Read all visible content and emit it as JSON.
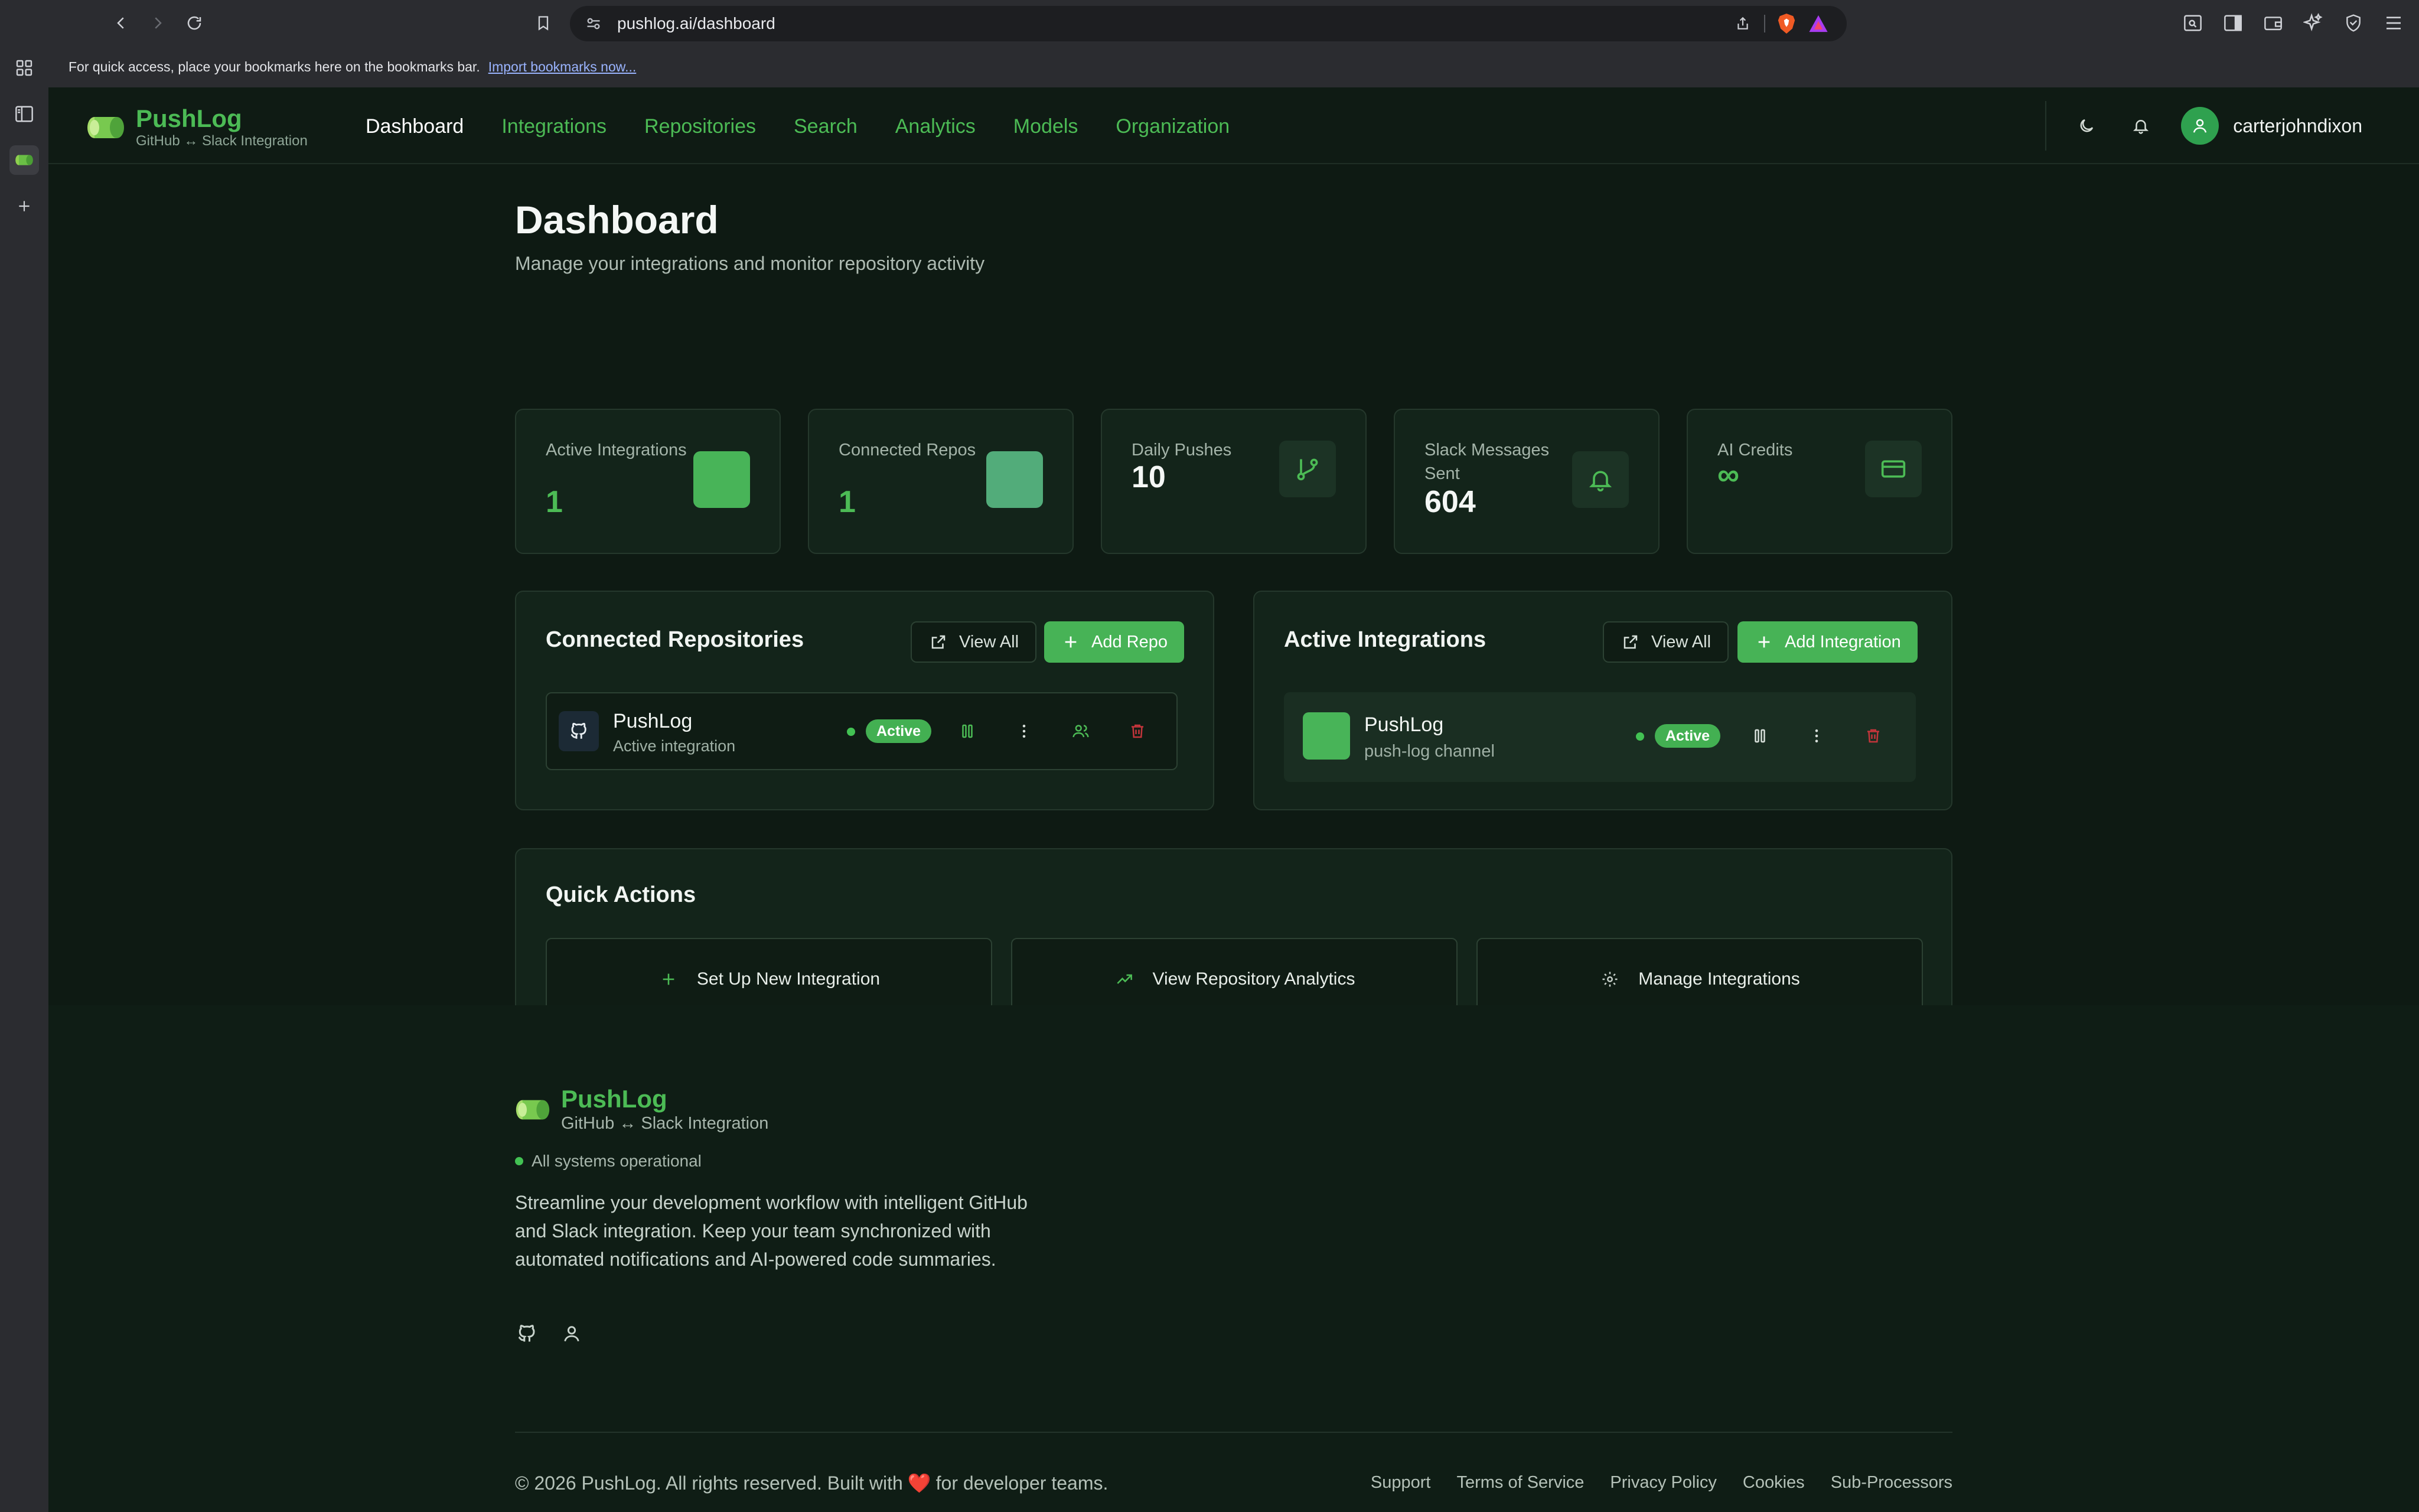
{
  "browser": {
    "url": "pushlog.ai/dashboard",
    "bookmarks_message": "For quick access, place your bookmarks here on the bookmarks bar.",
    "bookmarks_link": "Import bookmarks now..."
  },
  "brand": {
    "name": "PushLog",
    "tagline": "GitHub ↔ Slack Integration"
  },
  "nav": {
    "items": [
      "Dashboard",
      "Integrations",
      "Repositories",
      "Search",
      "Analytics",
      "Models",
      "Organization"
    ],
    "current": "Dashboard"
  },
  "user": {
    "name": "carterjohndixon"
  },
  "page": {
    "title": "Dashboard",
    "subtitle": "Manage your integrations and monitor repository activity"
  },
  "stats": [
    {
      "label": "Active Integrations",
      "value": "1"
    },
    {
      "label": "Connected Repos",
      "value": "1"
    },
    {
      "label": "Daily Pushes",
      "value": "10"
    },
    {
      "label": "Slack Messages Sent",
      "value": "604"
    },
    {
      "label": "AI Credits",
      "value": "∞"
    }
  ],
  "repos_panel": {
    "title": "Connected Repositories",
    "view_all": "View All",
    "add_label": "Add Repo",
    "item": {
      "name": "PushLog",
      "subtitle": "Active integration",
      "status": "Active"
    }
  },
  "integrations_panel": {
    "title": "Active Integrations",
    "view_all": "View All",
    "add_label": "Add Integration",
    "item": {
      "name": "PushLog",
      "subtitle": "push-log channel",
      "status": "Active"
    }
  },
  "quick_actions": {
    "title": "Quick Actions",
    "items": [
      "Set Up New Integration",
      "View Repository Analytics",
      "Manage Integrations"
    ]
  },
  "footer": {
    "brand": "PushLog",
    "tagline": "GitHub ↔ Slack Integration",
    "status": "All systems operational",
    "description": "Streamline your development workflow with intelligent GitHub and Slack integration. Keep your team synchronized with automated notifications and AI-powered code summaries.",
    "copyright_pre": "© 2026 PushLog. All rights reserved. Built with",
    "copyright_post": "for developer teams.",
    "links": [
      "Support",
      "Terms of Service",
      "Privacy Policy",
      "Cookies",
      "Sub-Processors"
    ]
  },
  "colors": {
    "accent": "#4cbb55",
    "background": "#0e1a13",
    "card": "#13241a",
    "danger": "#c3353b"
  }
}
